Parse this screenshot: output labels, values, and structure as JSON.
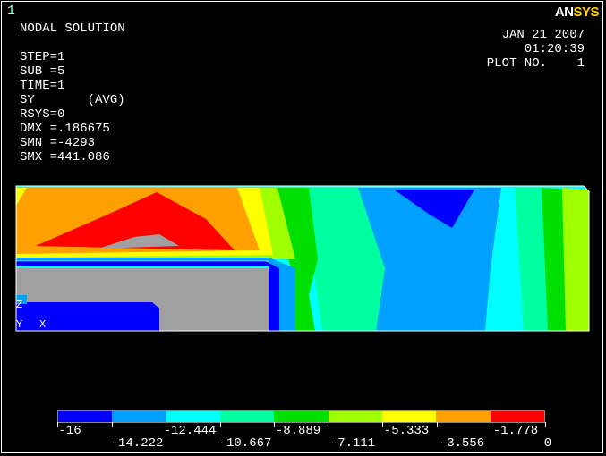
{
  "window_number": "1",
  "logo": {
    "part1": "AN",
    "part2": "SYS"
  },
  "info_lines": [
    "NODAL SOLUTION",
    "",
    "STEP=1",
    "SUB =5",
    "TIME=1",
    "SY       (AVG)",
    "RSYS=0",
    "DMX =.186675",
    "SMN =-4293",
    "SMX =441.086"
  ],
  "datetime": [
    "JAN 21 2007",
    "01:20:39",
    "PLOT NO.    1"
  ],
  "axis_labels": {
    "y": "Y",
    "x": "X",
    "z": "Z"
  },
  "colors": [
    "#0000ff",
    "#00a0ff",
    "#00ffff",
    "#00ffa0",
    "#00e000",
    "#a0ff00",
    "#ffff00",
    "#ffa000",
    "#ff0000",
    "#a0a0a0"
  ],
  "legend_colors": [
    "#0000ff",
    "#00a0ff",
    "#00ffff",
    "#00ffa0",
    "#00e000",
    "#a0ff00",
    "#ffff00",
    "#ffa000",
    "#ff0000"
  ],
  "legend_top": [
    "-16",
    "-12.444",
    "-8.889",
    "-5.333",
    "-1.778"
  ],
  "legend_bottom": [
    "-14.222",
    "-10.667",
    "-7.111",
    "-3.556",
    "0"
  ]
}
